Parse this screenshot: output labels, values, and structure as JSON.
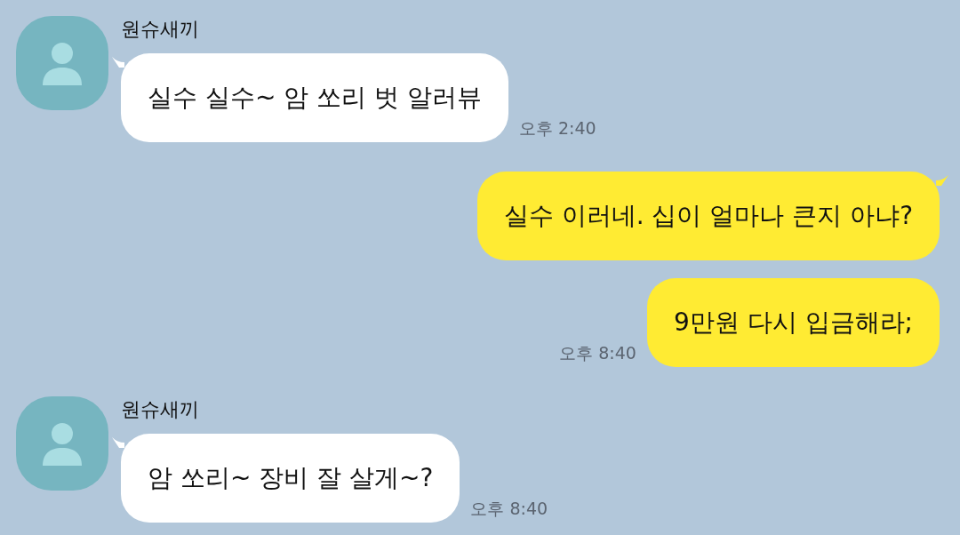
{
  "groups": [
    {
      "kind": "received",
      "sender": "원슈새끼",
      "messages": [
        {
          "text": "실수 실수~ 암 쏘리 벗 알러뷰",
          "time": "오후 2:40"
        }
      ]
    },
    {
      "kind": "sent",
      "messages": [
        {
          "text": "실수 이러네. 십이 얼마나 큰지 아냐?"
        },
        {
          "text": "9만원 다시 입금해라;",
          "time": "오후 8:40"
        }
      ]
    },
    {
      "kind": "received",
      "sender": "원슈새끼",
      "messages": [
        {
          "text": "암 쏘리~ 장비 잘 살게~?",
          "time": "오후 8:40"
        }
      ]
    }
  ]
}
